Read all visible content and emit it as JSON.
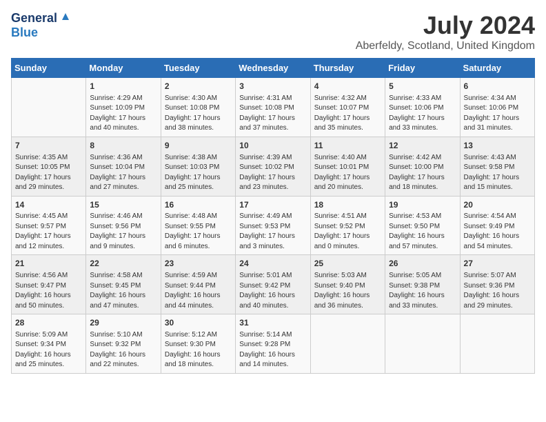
{
  "logo": {
    "line1": "General",
    "line2": "Blue"
  },
  "header": {
    "month_year": "July 2024",
    "location": "Aberfeldy, Scotland, United Kingdom"
  },
  "days_of_week": [
    "Sunday",
    "Monday",
    "Tuesday",
    "Wednesday",
    "Thursday",
    "Friday",
    "Saturday"
  ],
  "weeks": [
    [
      {
        "day": "",
        "content": ""
      },
      {
        "day": "1",
        "content": "Sunrise: 4:29 AM\nSunset: 10:09 PM\nDaylight: 17 hours\nand 40 minutes."
      },
      {
        "day": "2",
        "content": "Sunrise: 4:30 AM\nSunset: 10:08 PM\nDaylight: 17 hours\nand 38 minutes."
      },
      {
        "day": "3",
        "content": "Sunrise: 4:31 AM\nSunset: 10:08 PM\nDaylight: 17 hours\nand 37 minutes."
      },
      {
        "day": "4",
        "content": "Sunrise: 4:32 AM\nSunset: 10:07 PM\nDaylight: 17 hours\nand 35 minutes."
      },
      {
        "day": "5",
        "content": "Sunrise: 4:33 AM\nSunset: 10:06 PM\nDaylight: 17 hours\nand 33 minutes."
      },
      {
        "day": "6",
        "content": "Sunrise: 4:34 AM\nSunset: 10:06 PM\nDaylight: 17 hours\nand 31 minutes."
      }
    ],
    [
      {
        "day": "7",
        "content": "Sunrise: 4:35 AM\nSunset: 10:05 PM\nDaylight: 17 hours\nand 29 minutes."
      },
      {
        "day": "8",
        "content": "Sunrise: 4:36 AM\nSunset: 10:04 PM\nDaylight: 17 hours\nand 27 minutes."
      },
      {
        "day": "9",
        "content": "Sunrise: 4:38 AM\nSunset: 10:03 PM\nDaylight: 17 hours\nand 25 minutes."
      },
      {
        "day": "10",
        "content": "Sunrise: 4:39 AM\nSunset: 10:02 PM\nDaylight: 17 hours\nand 23 minutes."
      },
      {
        "day": "11",
        "content": "Sunrise: 4:40 AM\nSunset: 10:01 PM\nDaylight: 17 hours\nand 20 minutes."
      },
      {
        "day": "12",
        "content": "Sunrise: 4:42 AM\nSunset: 10:00 PM\nDaylight: 17 hours\nand 18 minutes."
      },
      {
        "day": "13",
        "content": "Sunrise: 4:43 AM\nSunset: 9:58 PM\nDaylight: 17 hours\nand 15 minutes."
      }
    ],
    [
      {
        "day": "14",
        "content": "Sunrise: 4:45 AM\nSunset: 9:57 PM\nDaylight: 17 hours\nand 12 minutes."
      },
      {
        "day": "15",
        "content": "Sunrise: 4:46 AM\nSunset: 9:56 PM\nDaylight: 17 hours\nand 9 minutes."
      },
      {
        "day": "16",
        "content": "Sunrise: 4:48 AM\nSunset: 9:55 PM\nDaylight: 17 hours\nand 6 minutes."
      },
      {
        "day": "17",
        "content": "Sunrise: 4:49 AM\nSunset: 9:53 PM\nDaylight: 17 hours\nand 3 minutes."
      },
      {
        "day": "18",
        "content": "Sunrise: 4:51 AM\nSunset: 9:52 PM\nDaylight: 17 hours\nand 0 minutes."
      },
      {
        "day": "19",
        "content": "Sunrise: 4:53 AM\nSunset: 9:50 PM\nDaylight: 16 hours\nand 57 minutes."
      },
      {
        "day": "20",
        "content": "Sunrise: 4:54 AM\nSunset: 9:49 PM\nDaylight: 16 hours\nand 54 minutes."
      }
    ],
    [
      {
        "day": "21",
        "content": "Sunrise: 4:56 AM\nSunset: 9:47 PM\nDaylight: 16 hours\nand 50 minutes."
      },
      {
        "day": "22",
        "content": "Sunrise: 4:58 AM\nSunset: 9:45 PM\nDaylight: 16 hours\nand 47 minutes."
      },
      {
        "day": "23",
        "content": "Sunrise: 4:59 AM\nSunset: 9:44 PM\nDaylight: 16 hours\nand 44 minutes."
      },
      {
        "day": "24",
        "content": "Sunrise: 5:01 AM\nSunset: 9:42 PM\nDaylight: 16 hours\nand 40 minutes."
      },
      {
        "day": "25",
        "content": "Sunrise: 5:03 AM\nSunset: 9:40 PM\nDaylight: 16 hours\nand 36 minutes."
      },
      {
        "day": "26",
        "content": "Sunrise: 5:05 AM\nSunset: 9:38 PM\nDaylight: 16 hours\nand 33 minutes."
      },
      {
        "day": "27",
        "content": "Sunrise: 5:07 AM\nSunset: 9:36 PM\nDaylight: 16 hours\nand 29 minutes."
      }
    ],
    [
      {
        "day": "28",
        "content": "Sunrise: 5:09 AM\nSunset: 9:34 PM\nDaylight: 16 hours\nand 25 minutes."
      },
      {
        "day": "29",
        "content": "Sunrise: 5:10 AM\nSunset: 9:32 PM\nDaylight: 16 hours\nand 22 minutes."
      },
      {
        "day": "30",
        "content": "Sunrise: 5:12 AM\nSunset: 9:30 PM\nDaylight: 16 hours\nand 18 minutes."
      },
      {
        "day": "31",
        "content": "Sunrise: 5:14 AM\nSunset: 9:28 PM\nDaylight: 16 hours\nand 14 minutes."
      },
      {
        "day": "",
        "content": ""
      },
      {
        "day": "",
        "content": ""
      },
      {
        "day": "",
        "content": ""
      }
    ]
  ]
}
